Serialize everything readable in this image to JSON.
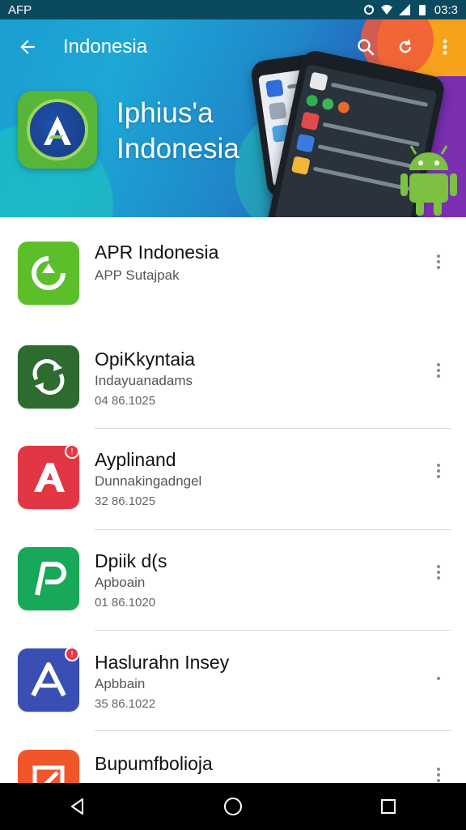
{
  "status_bar": {
    "left_label": "AFP",
    "time": "03:3",
    "icons": [
      "sync-icon",
      "wifi-icon",
      "signal-icon",
      "battery-icon"
    ]
  },
  "toolbar": {
    "title": "Indonesia",
    "icons": [
      "back-arrow-icon",
      "search-icon",
      "refresh-icon",
      "more-vert-icon"
    ]
  },
  "hero": {
    "title_line1": "Iphius'a",
    "title_line2": "Indonesia"
  },
  "apps": [
    {
      "name": "APR Indonesia",
      "subtitle": "APP Sutajpak",
      "date": "",
      "icon_color": "#5cbf2a",
      "icon": "refresh-arrow-icon",
      "badge": false
    },
    {
      "name": "OpiKkyntaia",
      "subtitle": "Indayuanadams",
      "date": "04 86.1025",
      "icon_color": "#2d6b2f",
      "icon": "sync-arrows-icon",
      "badge": false
    },
    {
      "name": "Ayplinand",
      "subtitle": "Dunnakingadngel",
      "date": "32 86.1025",
      "icon_color": "#e13744",
      "icon": "letter-a-icon",
      "badge": true
    },
    {
      "name": "Dpiik d(s",
      "subtitle": "Apboain",
      "date": "01 86.1020",
      "icon_color": "#17a85a",
      "icon": "letter-p-icon",
      "badge": false
    },
    {
      "name": "Haslurahn Insey",
      "subtitle": "Apbbain",
      "date": "35 86.1022",
      "icon_color": "#3a4fb4",
      "icon": "letter-a-outline-icon",
      "badge": true
    },
    {
      "name": "Bupumfbolioja",
      "subtitle": "",
      "date": "",
      "icon_color": "#f0562a",
      "icon": "square-slash-icon",
      "badge": false
    }
  ],
  "nav_bar": {
    "icons": [
      "nav-back-icon",
      "nav-home-icon",
      "nav-recents-icon"
    ]
  },
  "colors": {
    "status_bar": "#0b4a5e",
    "hero_start": "#1a9fd0",
    "hero_end": "#6b3bb0",
    "divider": "#d9d9d9"
  }
}
